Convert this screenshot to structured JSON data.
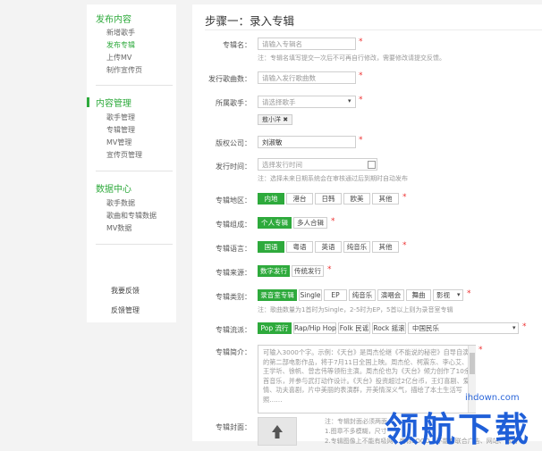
{
  "sidebar": {
    "sections": [
      {
        "title": "发布内容",
        "items": [
          "新增歌手",
          "发布专辑",
          "上传MV",
          "制作宣传页"
        ]
      },
      {
        "title": "内容管理",
        "items": [
          "歌手管理",
          "专辑管理",
          "MV管理",
          "宣传页管理"
        ]
      },
      {
        "title": "数据中心",
        "items": [
          "歌手数据",
          "歌曲和专辑数据",
          "MV数据"
        ]
      }
    ],
    "active_item": "发布专辑",
    "feedback": [
      "我要反馈",
      "反馈管理"
    ]
  },
  "form": {
    "heading": "步骤一：录入专辑",
    "album_name": {
      "label": "专辑名：",
      "placeholder": "请输入专辑名",
      "hint": "注：专辑名填写提交一次后不可再自行修改，需要修改请提交反馈。"
    },
    "publisher": {
      "label": "发行歌曲数：",
      "placeholder": "请输入发行歌曲数"
    },
    "artist": {
      "label": "所属歌手：",
      "placeholder": "请选择歌手",
      "tag": "敖小洋 ✖"
    },
    "copyright": {
      "label": "版权公司：",
      "value": "刘淑敏"
    },
    "release_time": {
      "label": "发行时间：",
      "placeholder": "选择发行时间",
      "hint": "注：选择未来日期系统会在审核通过后到期时自动发布"
    },
    "region": {
      "label": "专辑地区：",
      "options": [
        "内地",
        "港台",
        "日韩",
        "欧美",
        "其他"
      ],
      "selected": 0
    },
    "group": {
      "label": "专辑组成：",
      "options": [
        "个人专辑",
        "多人合辑"
      ],
      "selected": 0
    },
    "language": {
      "label": "专辑语言：",
      "options": [
        "国语",
        "粤语",
        "英语",
        "纯音乐",
        "其他"
      ],
      "selected": 0
    },
    "source": {
      "label": "专辑来源：",
      "options": [
        "数字发行",
        "传统发行"
      ],
      "selected": 0
    },
    "category": {
      "label": "专辑类别：",
      "options": [
        "录音室专辑",
        "Single",
        "EP",
        "纯音乐",
        "演唱会",
        "舞曲",
        "影视"
      ],
      "selected": 0,
      "hint": "注：歌曲数量为1首时为Single，2-5时为EP，5首以上则为录音室专辑"
    },
    "genre": {
      "label": "专辑流派：",
      "options": [
        "Pop 流行",
        "Rap/Hip Hop",
        "Folk 民谣",
        "Rock 摇滚"
      ],
      "selected": 0,
      "select_value": "中国民乐"
    },
    "intro": {
      "label": "专辑简介：",
      "text": "可输入3000个字。示例：《天台》是周杰伦继《不能说的秘密》自导自演的第二部电影作品，将于7月11日全国上映。周杰伦、柯震东、李心艾、王学圻、徐帆、曾志伟等领衔主演。周杰伦也为《天台》倾力创作了10余首音乐，并参与武打动作设计。《天台》投资超过2亿台币，王灯喜剧、爱情、功夫喜剧，片中美丽的表演群，开美情深义气，描绘了本土生活写照……"
    },
    "cover": {
      "label": "专辑封面：",
      "hint1": "注：专辑封面必须两面",
      "hint2": "1.图章不多模糊，尺寸",
      "hint3": "2.专辑图像上不能有吸网、商标LOGO、不能有联合广告、网站、微信"
    }
  },
  "watermark": {
    "site": "ihdown.com",
    "brand": "领航下载"
  },
  "colors": {
    "accent": "#2eaa3c",
    "required": "#e33333"
  }
}
